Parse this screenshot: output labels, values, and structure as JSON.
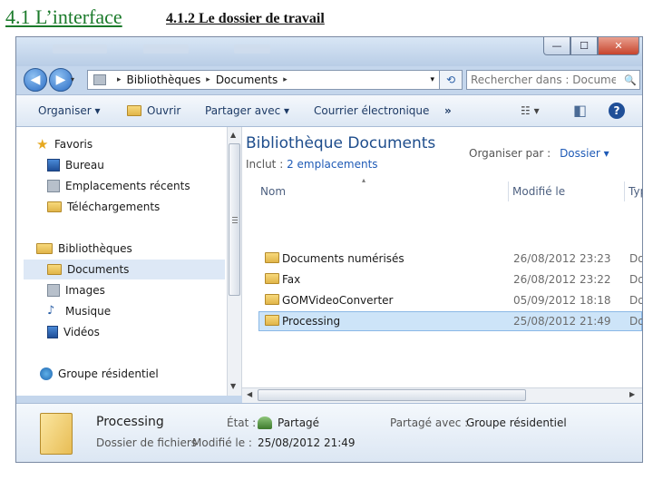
{
  "slide": {
    "title": "4.1 L’interface",
    "subtitle": "4.1.2 Le dossier de travail"
  },
  "window": {
    "controls": {
      "minimize": "—",
      "maximize": "☐",
      "close": "✕"
    },
    "nav": {
      "back_glyph": "◀",
      "forward_glyph": "▶",
      "dropdown_glyph": "▾"
    },
    "address": {
      "path": [
        "Bibliothèques",
        "Documents"
      ],
      "separator": "▸",
      "refresh_glyph": "⟲"
    },
    "search": {
      "placeholder": "Rechercher dans : Documen...",
      "icon": "🔍"
    },
    "toolbar": {
      "organize": "Organiser ▾",
      "open": "Ouvrir",
      "share": "Partager avec ▾",
      "email": "Courrier électronique",
      "more": "»",
      "view_glyph": "☷ ▾",
      "pane_glyph": "◧",
      "help_glyph": "?"
    },
    "sidebar": {
      "favorites": {
        "label": "Favoris",
        "items": [
          "Bureau",
          "Emplacements récents",
          "Téléchargements"
        ]
      },
      "libraries": {
        "label": "Bibliothèques",
        "items": [
          "Documents",
          "Images",
          "Musique",
          "Vidéos"
        ],
        "selected": "Documents"
      },
      "homegroup": "Groupe résidentiel"
    },
    "content": {
      "library_title": "Bibliothèque Documents",
      "includes_label": "Inclut :",
      "includes_link": "2 emplacements",
      "arrange_label": "Organiser par :",
      "arrange_value": "Dossier ▾",
      "sort_glyph": "▴",
      "columns": {
        "name": "Nom",
        "modified": "Modifié le",
        "type": "Type"
      },
      "rows": [
        {
          "name": "Documents numérisés",
          "modified": "26/08/2012 23:23",
          "type": "Doss"
        },
        {
          "name": "Fax",
          "modified": "26/08/2012 23:22",
          "type": "Doss"
        },
        {
          "name": "GOMVideoConverter",
          "modified": "05/09/2012 18:18",
          "type": "Doss"
        },
        {
          "name": "Processing",
          "modified": "25/08/2012 21:49",
          "type": "Doss"
        }
      ],
      "selected_row": 3
    },
    "details": {
      "name": "Processing",
      "kind": "Dossier de fichiers",
      "state_label": "État :",
      "state_value": "Partagé",
      "shared_label": "Partagé avec :",
      "shared_value": "Groupe résidentiel",
      "modified_label": "Modifié le :",
      "modified_value": "25/08/2012 21:49"
    },
    "accent_color": "#1e4d8c",
    "selection_color": "#cde4f8"
  }
}
